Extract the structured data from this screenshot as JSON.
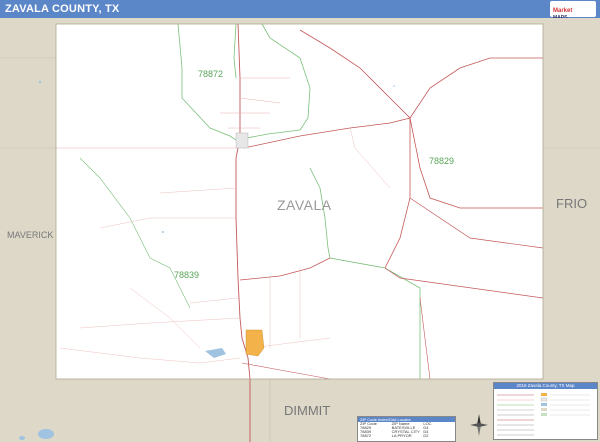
{
  "title": "ZAVALA COUNTY, TX",
  "county_label": "ZAVALA",
  "neighbors": {
    "west": "MAVERICK",
    "east": "FRIO",
    "south": "DIMMIT"
  },
  "zip_labels": [
    "78872",
    "78829",
    "78839"
  ],
  "zip_table": {
    "title": "ZIP Code Index/Grid Locator",
    "headers": [
      "ZIP Code",
      "ZIP Name",
      "LOC"
    ],
    "rows": [
      [
        "78829",
        "BATESVILLE",
        "D4"
      ],
      [
        "78839",
        "CRYSTAL CITY",
        "D4"
      ],
      [
        "78872",
        "LA PRYOR",
        "D2"
      ]
    ]
  },
  "legend": {
    "title": "2016 Zavala County, TX Map"
  },
  "colors": {
    "title_bar": "#5b86c8",
    "outside_county": "#ddd8c8",
    "county": "#ffffff",
    "roads": "#c4585a",
    "minor_roads": "#e8b0b0",
    "zip_boundary": "#7ac07a",
    "city": "#f3b24a"
  }
}
